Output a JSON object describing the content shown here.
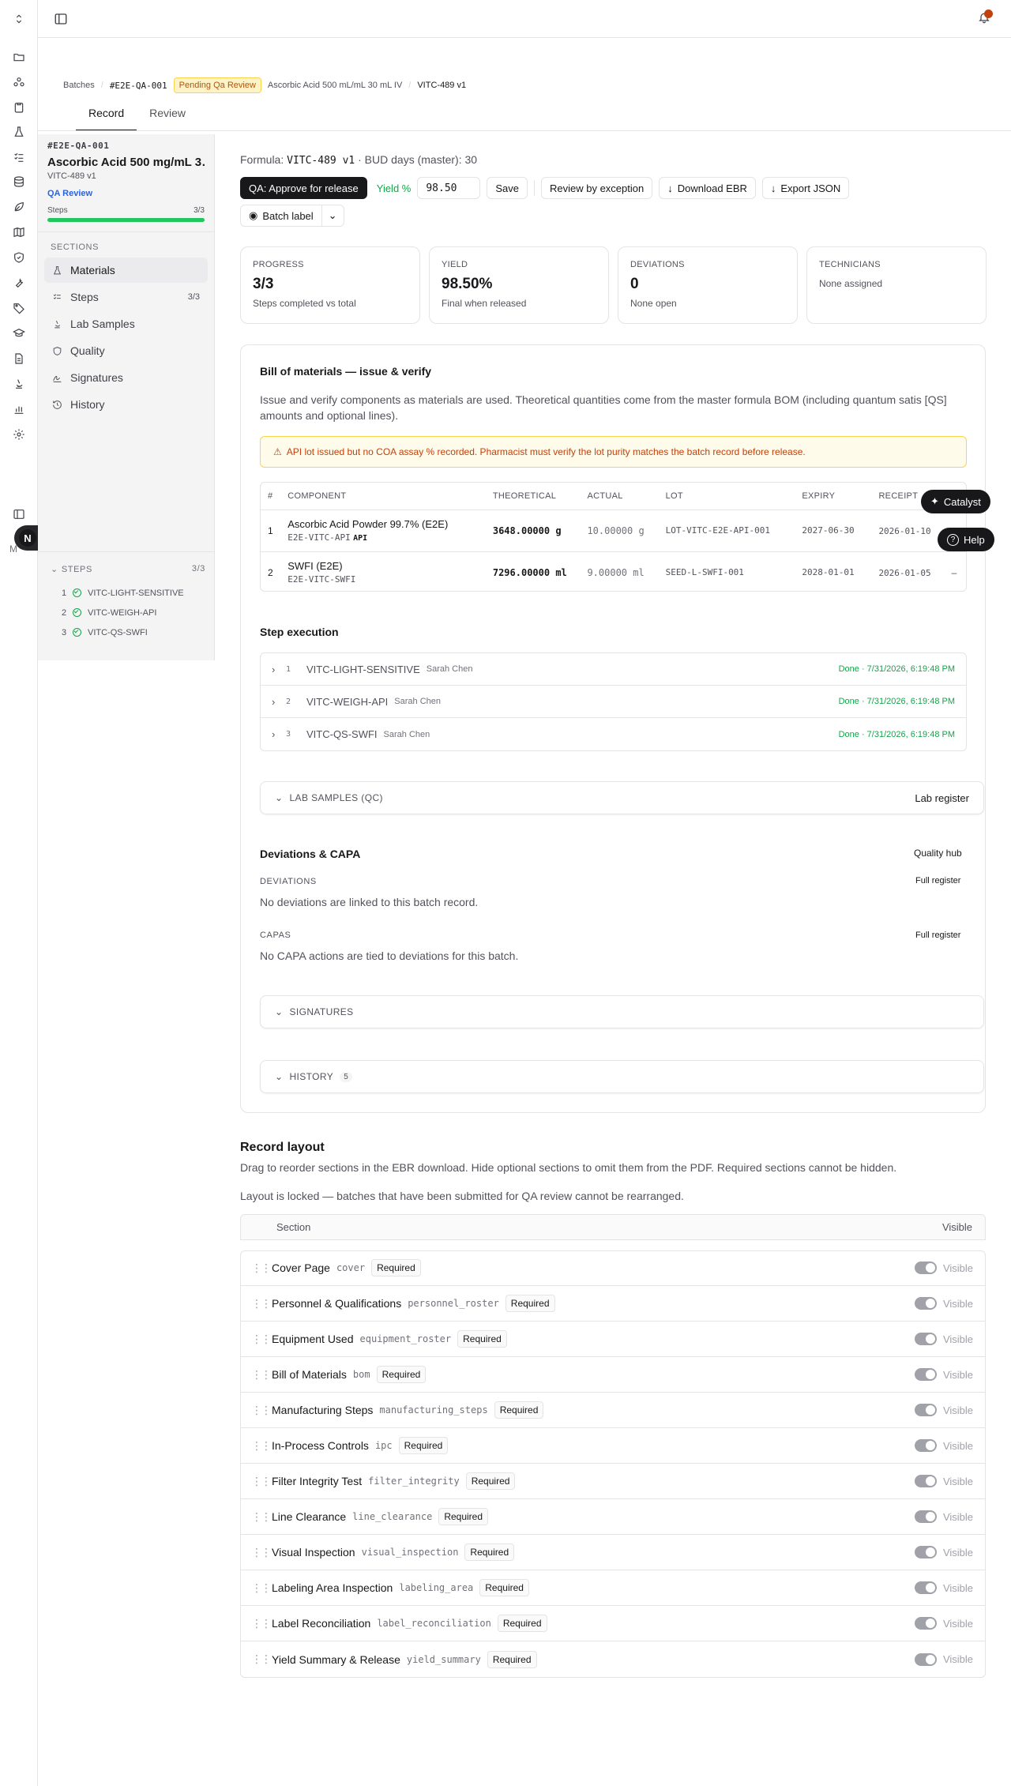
{
  "topbar": {
    "project_switcher_icon": "chevron-up-down",
    "sidebar_toggle_icon": "panel-left",
    "notification_icon": "bell"
  },
  "rail": {
    "icons": [
      "folder-icon",
      "network-icon",
      "clipboard-icon",
      "flask-icon",
      "checklist-icon",
      "database-icon",
      "leaf-icon",
      "map-icon",
      "shield-icon",
      "wrench-icon",
      "tag-icon",
      "graduation-cap-icon",
      "file-icon",
      "microscope-icon",
      "bar-chart-icon",
      "gear-icon"
    ],
    "avatar_letter": "N",
    "avatar_count": "1",
    "avatar_sub": "M"
  },
  "breadcrumb": {
    "batches": "Batches",
    "batch_id": "#E2E-QA-001",
    "status": "Pending Qa Review",
    "product": "Ascorbic Acid 500 mL/mL 30 mL IV",
    "formula": "VITC-489 v1"
  },
  "tabs": [
    "Record",
    "Review"
  ],
  "sidebar": {
    "batch_id": "#E2E-QA-001",
    "title": "Ascorbic Acid 500 mg/mL 3…",
    "formula": "VITC-489 v1",
    "status": "QA Review",
    "steps_label": "Steps",
    "steps_count": "3/3",
    "steps_progress": 1.0,
    "sections_header": "SECTIONS",
    "sections": [
      {
        "label": "Materials",
        "icon": "flask-icon",
        "count": ""
      },
      {
        "label": "Steps",
        "icon": "checklist-icon",
        "count": "3/3"
      },
      {
        "label": "Lab Samples",
        "icon": "microscope-icon",
        "count": ""
      },
      {
        "label": "Quality",
        "icon": "shield-icon",
        "count": ""
      },
      {
        "label": "Signatures",
        "icon": "signature-icon",
        "count": ""
      },
      {
        "label": "History",
        "icon": "history-icon",
        "count": ""
      }
    ],
    "steps_header": "STEPS",
    "steps_header_count": "3/3",
    "steps": [
      {
        "num": "1",
        "label": "VITC-LIGHT-SENSITIVE"
      },
      {
        "num": "2",
        "label": "VITC-WEIGH-API"
      },
      {
        "num": "3",
        "label": "VITC-QS-SWFI"
      }
    ]
  },
  "header": {
    "formula_label": "Formula:",
    "formula_value": "VITC-489 v1",
    "bud_text": "BUD days (master): 30",
    "approve_button": "QA: Approve for release",
    "yield_label": "Yield %",
    "yield_value": "98.50",
    "save_button": "Save",
    "review_exception_button": "Review by exception",
    "download_button": "Download EBR",
    "export_button": "Export JSON",
    "batch_label_button": "Batch label"
  },
  "stats": [
    {
      "label": "PROGRESS",
      "value": "3/3",
      "sub": "Steps completed vs total"
    },
    {
      "label": "YIELD",
      "value": "98.50%",
      "sub": "Final when released"
    },
    {
      "label": "DEVIATIONS",
      "value": "0",
      "sub": "None open"
    },
    {
      "label": "TECHNICIANS",
      "value": "",
      "sub": "None assigned"
    }
  ],
  "bom": {
    "title": "Bill of materials — issue & verify",
    "description": "Issue and verify components as materials are used. Theoretical quantities come from the master formula BOM (including quantum satis [QS] amounts and optional lines).",
    "warning": "API lot issued but no COA assay % recorded. Pharmacist must verify the lot purity matches the batch record before release.",
    "columns": [
      "#",
      "COMPONENT",
      "THEORETICAL",
      "ACTUAL",
      "LOT",
      "EXPIRY",
      "RECEIPT"
    ],
    "rows": [
      {
        "num": "1",
        "name": "Ascorbic Acid Powder 99.7% (E2E)",
        "code": "E2E-VITC-API",
        "tag": "API",
        "theoretical": "3648.00000 g",
        "actual": "10.00000 g",
        "lot": "LOT-VITC-E2E-API-001",
        "expiry": "2027-06-30",
        "receipt": "2026-01-10",
        "extra": ""
      },
      {
        "num": "2",
        "name": "SWFI (E2E)",
        "code": "E2E-VITC-SWFI",
        "tag": "",
        "theoretical": "7296.00000 ml",
        "actual": "9.00000 ml",
        "lot": "SEED-L-SWFI-001",
        "expiry": "2028-01-01",
        "receipt": "2026-01-05",
        "extra": "–"
      }
    ]
  },
  "steps": {
    "title": "Step execution",
    "rows": [
      {
        "num": "1",
        "name": "VITC-LIGHT-SENSITIVE",
        "tech": "Sarah Chen",
        "status": "Done · 7/31/2026, 6:19:48 PM"
      },
      {
        "num": "2",
        "name": "VITC-WEIGH-API",
        "tech": "Sarah Chen",
        "status": "Done · 7/31/2026, 6:19:48 PM"
      },
      {
        "num": "3",
        "name": "VITC-QS-SWFI",
        "tech": "Sarah Chen",
        "status": "Done · 7/31/2026, 6:19:48 PM"
      }
    ]
  },
  "lab_samples": {
    "title": "LAB SAMPLES (QC)",
    "link": "Lab register"
  },
  "deviations": {
    "title": "Deviations & CAPA",
    "hub_link": "Quality hub",
    "deviations_label": "DEVIATIONS",
    "deviations_link": "Full register",
    "deviations_empty": "No deviations are linked to this batch record.",
    "capas_label": "CAPAS",
    "capas_link": "Full register",
    "capas_empty": "No CAPA actions are tied to deviations for this batch."
  },
  "signatures": {
    "title": "SIGNATURES"
  },
  "history": {
    "title": "HISTORY",
    "count": "5"
  },
  "layout": {
    "title": "Record layout",
    "description": "Drag to reorder sections in the EBR download. Hide optional sections to omit them from the PDF. Required sections cannot be hidden.",
    "locked_note": "Layout is locked — batches that have been submitted for QA review cannot be rearranged.",
    "col_section": "Section",
    "col_visible": "Visible",
    "required_label": "Required",
    "visible_label": "Visible",
    "rows": [
      {
        "name": "Cover Page",
        "key": "cover"
      },
      {
        "name": "Personnel & Qualifications",
        "key": "personnel_roster"
      },
      {
        "name": "Equipment Used",
        "key": "equipment_roster"
      },
      {
        "name": "Bill of Materials",
        "key": "bom"
      },
      {
        "name": "Manufacturing Steps",
        "key": "manufacturing_steps"
      },
      {
        "name": "In-Process Controls",
        "key": "ipc"
      },
      {
        "name": "Filter Integrity Test",
        "key": "filter_integrity"
      },
      {
        "name": "Line Clearance",
        "key": "line_clearance"
      },
      {
        "name": "Visual Inspection",
        "key": "visual_inspection"
      },
      {
        "name": "Labeling Area Inspection",
        "key": "labeling_area"
      },
      {
        "name": "Label Reconciliation",
        "key": "label_reconciliation"
      },
      {
        "name": "Yield Summary & Release",
        "key": "yield_summary"
      }
    ]
  },
  "floating": {
    "catalyst": "Catalyst",
    "help": "Help"
  },
  "colors": {
    "accent": "#18181b",
    "success": "#16a34a",
    "warning_bg": "#fffbeb",
    "warning_text": "#c2410c",
    "progress": "#22c55e",
    "link_blue": "#2563eb"
  }
}
